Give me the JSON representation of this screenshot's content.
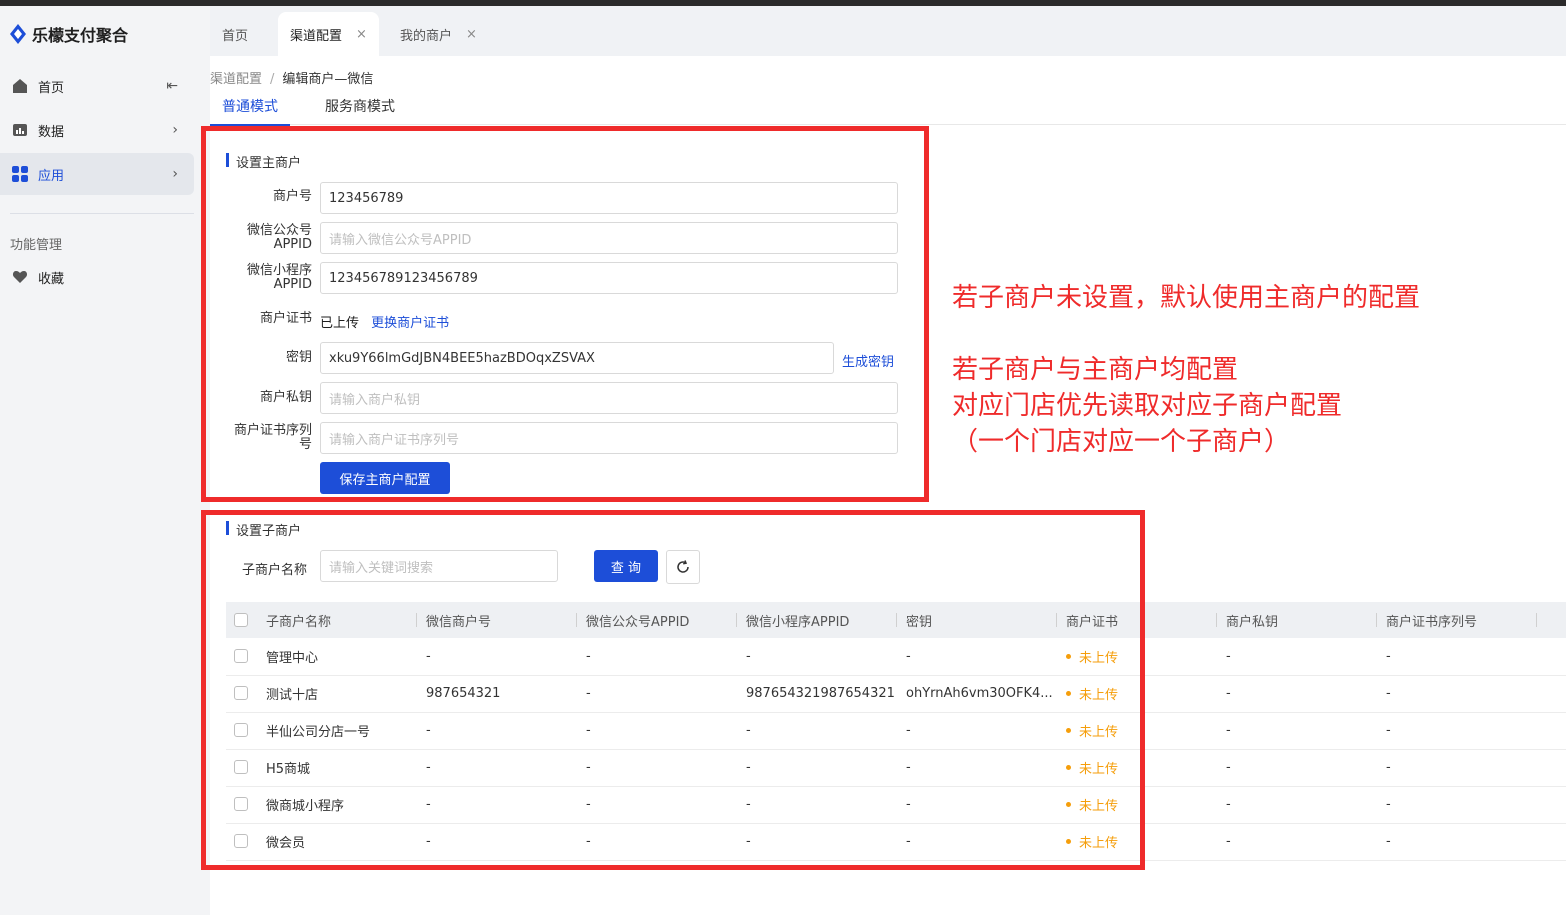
{
  "app": {
    "name": "乐檬支付聚合"
  },
  "sidebar": {
    "items": [
      {
        "label": "首页",
        "icon": "home-icon",
        "chevron": "⇤"
      },
      {
        "label": "数据",
        "icon": "chart-icon",
        "chevron": "›"
      },
      {
        "label": "应用",
        "icon": "apps-icon",
        "chevron": "›"
      }
    ],
    "section_label": "功能管理",
    "favorites_label": "收藏"
  },
  "tabs": [
    {
      "label": "首页"
    },
    {
      "label": "渠道配置",
      "close": "×"
    },
    {
      "label": "我的商户",
      "close": "×"
    }
  ],
  "breadcrumb": {
    "parent": "渠道配置",
    "separator": "/",
    "current": "编辑商户—微信"
  },
  "mode_tabs": [
    {
      "label": "普通模式"
    },
    {
      "label": "服务商模式"
    }
  ],
  "main_merchant": {
    "title": "设置主商户",
    "merchant_no_label": "商户号",
    "merchant_no_value": "123456789",
    "oa_appid_label_1": "微信公众号",
    "oa_appid_label_2": "APPID",
    "oa_appid_placeholder": "请输入微信公众号APPID",
    "mp_appid_label_1": "微信小程序",
    "mp_appid_label_2": "APPID",
    "mp_appid_value": "123456789123456789",
    "cert_label": "商户证书",
    "cert_status": "已上传",
    "cert_change_link": "更换商户证书",
    "secret_label": "密钥",
    "secret_value": "xku9Y66lmGdJBN4BEE5hazBDOqxZSVAX",
    "generate_secret_link": "生成密钥",
    "private_key_label": "商户私钥",
    "private_key_placeholder": "请输入商户私钥",
    "cert_serial_label_1": "商户证书序列",
    "cert_serial_label_2": "号",
    "cert_serial_placeholder": "请输入商户证书序列号",
    "save_button": "保存主商户配置"
  },
  "sub_merchant": {
    "title": "设置子商户",
    "name_label": "子商户名称",
    "search_placeholder": "请输入关键词搜索",
    "query_button": "查 询",
    "columns": [
      "子商户名称",
      "微信商户号",
      "微信公众号APPID",
      "微信小程序APPID",
      "密钥",
      "商户证书",
      "商户私钥",
      "商户证书序列号"
    ],
    "rows": [
      {
        "name": "管理中心",
        "mch_no": "-",
        "oa_appid": "-",
        "mp_appid": "-",
        "secret": "-",
        "cert": "未上传",
        "private_key": "-",
        "serial": "-"
      },
      {
        "name": "测试十店",
        "mch_no": "987654321",
        "oa_appid": "-",
        "mp_appid": "987654321987654321",
        "secret": "ohYrnAh6vm30OFK4...",
        "cert": "未上传",
        "private_key": "-",
        "serial": "-"
      },
      {
        "name": "半仙公司分店一号",
        "mch_no": "-",
        "oa_appid": "-",
        "mp_appid": "-",
        "secret": "-",
        "cert": "未上传",
        "private_key": "-",
        "serial": "-"
      },
      {
        "name": "H5商城",
        "mch_no": "-",
        "oa_appid": "-",
        "mp_appid": "-",
        "secret": "-",
        "cert": "未上传",
        "private_key": "-",
        "serial": "-"
      },
      {
        "name": "微商城小程序",
        "mch_no": "-",
        "oa_appid": "-",
        "mp_appid": "-",
        "secret": "-",
        "cert": "未上传",
        "private_key": "-",
        "serial": "-"
      },
      {
        "name": "微会员",
        "mch_no": "-",
        "oa_appid": "-",
        "mp_appid": "-",
        "secret": "-",
        "cert": "未上传",
        "private_key": "-",
        "serial": "-"
      }
    ]
  },
  "annotations": {
    "note1": "若子商户未设置，默认使用主商户的配置",
    "note2": "若子商户与主商户均配置",
    "note3": "对应门店优先读取对应子商户配置",
    "note4": "（一个门店对应一个子商户）"
  },
  "colors": {
    "accent": "#1d4ed8",
    "annotation_red": "#ef2b2b",
    "status_orange": "#f59e0b"
  }
}
